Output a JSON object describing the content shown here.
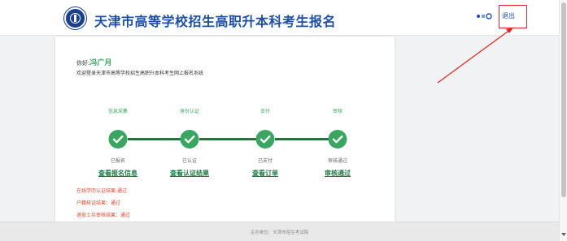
{
  "header": {
    "site_title": "天津市高等学校招生高职升本科考生报名",
    "logout_label": "退出"
  },
  "card": {
    "greeting_prefix": "你好:",
    "user_name": "冯广月",
    "welcome_text": "欢迎登录天津市高等学校招生高职升本科考生网上报名系统"
  },
  "steps": [
    {
      "title": "信息采集",
      "status": "已报名",
      "link": "查看报名信息"
    },
    {
      "title": "身份认证",
      "status": "已认证",
      "link": "查看认证结果"
    },
    {
      "title": "支付",
      "status": "已支付",
      "link": "查看订单"
    },
    {
      "title": "审核",
      "status": "审核通过",
      "link": "审核通过"
    }
  ],
  "results": [
    "在线学历认证结果:通过",
    "户籍核证结果：通过",
    "退役士兵审核结果：通过"
  ],
  "footer": {
    "text": "主办单位：天津市招生考试院"
  },
  "colors": {
    "brand_blue": "#1d4fa2",
    "step_green": "#3aa661",
    "link_green": "#1e7a45",
    "result_red": "#e0452b",
    "highlight_red": "#e0231f"
  },
  "icons": {
    "logo": "university-seal-icon",
    "tool": "settings-icon",
    "step": "check-circle-icon"
  }
}
